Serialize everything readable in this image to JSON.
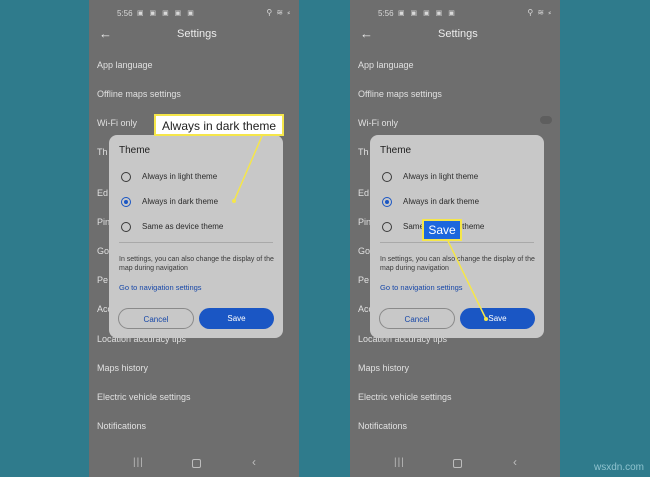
{
  "status_bar": {
    "time": "5:56",
    "notif_icons": "▣ ▣ ▣ ▣ ▣",
    "sys_icons": "⚲ ≋ ⸗"
  },
  "header": {
    "title": "Settings"
  },
  "settings_items_left": [
    "App language",
    "Offline maps settings",
    "Wi-Fi only",
    "Th",
    "Ed",
    "Pin",
    "Go",
    "Pe",
    "Acc",
    "Location accuracy tips",
    "Maps history",
    "Electric vehicle settings",
    "Notifications"
  ],
  "settings_items_right": [
    "App language",
    "Offline maps settings",
    "Wi-Fi only",
    "Th",
    "Ed",
    "Pin",
    "Go",
    "Pe",
    "Acc",
    "Location accuracy tips",
    "Maps history",
    "Electric vehicle settings",
    "Notifications"
  ],
  "dialog": {
    "title": "Theme",
    "options": [
      "Always in light theme",
      "Always in dark theme",
      "Same as device theme"
    ],
    "options_right": [
      "Always in light theme",
      "Always in dark theme",
      "Same as device theme"
    ],
    "selected_option": "Always in dark theme",
    "note": "In settings, you can also change the display of the map during navigation",
    "nav_link": "Go to navigation settings",
    "cancel": "Cancel",
    "save": "Save"
  },
  "nav_bar": {
    "recent": "|||",
    "back": "‹"
  },
  "callouts": {
    "dark_theme": "Always in dark theme",
    "save": "Save"
  },
  "watermark": "wsxdn.com",
  "colors": {
    "background": "#2f7b8c",
    "phone_dim": "#6e6e6e",
    "dialog": "#c8c8c8",
    "accent_blue": "#1a56c4",
    "callout_border": "#f5e64a"
  }
}
